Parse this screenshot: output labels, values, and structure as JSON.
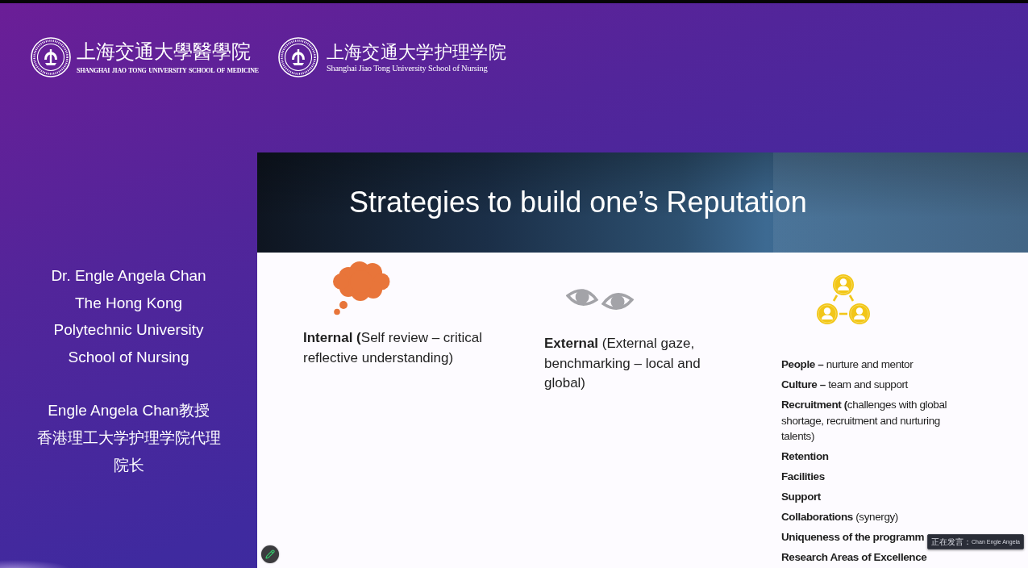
{
  "header": {
    "logos": [
      {
        "kind": "medicine",
        "name_zh": "上海交通大學醫學院",
        "name_en": "SHANGHAI JIAO TONG UNIVERSITY SCHOOL OF MEDICINE"
      },
      {
        "kind": "nursing",
        "name_zh": "上海交通大学护理学院",
        "name_en": "Shanghai Jiao Tong University School of Nursing"
      }
    ]
  },
  "speaker_panel": {
    "blocks": [
      [
        "Dr. Engle Angela Chan",
        "The Hong Kong",
        "Polytechnic University",
        "School of Nursing"
      ],
      [
        "Engle Angela Chan教授",
        "香港理工大学护理学院代理",
        "院长"
      ]
    ]
  },
  "slide": {
    "title": "Strategies to build one’s Reputation",
    "columns": [
      {
        "kind": "thought",
        "text": "**Internal (**Self review – critical reflective understanding)"
      },
      {
        "kind": "eyes",
        "text": "**External** (External gaze, benchmarking – local and global)"
      },
      {
        "kind": "network",
        "items": [
          "**People –** nurture and mentor",
          "**Culture –** team and support",
          "**Recruitment (**challenges with global shortage, recruitment and nurturing talents)",
          "**Retention**",
          "**Facilities**",
          "**Support**",
          "**Collaborations** (synergy)",
          "**Uniqueness of the programm**",
          "**Research Areas of Excellence**"
        ]
      }
    ]
  },
  "speaker_toast": {
    "label": "正在发言：",
    "name": "Chan Engle Angela"
  }
}
